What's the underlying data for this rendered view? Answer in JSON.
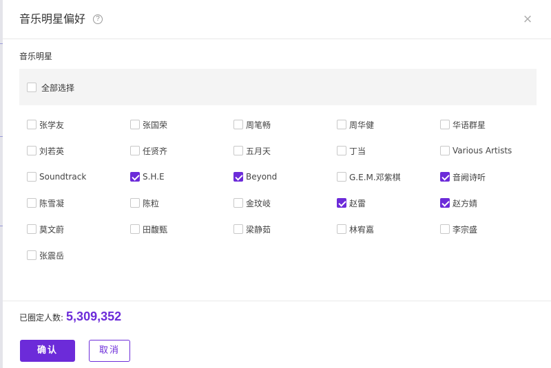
{
  "dialog": {
    "title": "音乐明星偏好",
    "help_icon": "help-circle-icon",
    "close_icon": "close-icon",
    "close_glyph": "×",
    "help_glyph": "?"
  },
  "section": {
    "label": "音乐明星",
    "select_all_label": "全部选择",
    "select_all_checked": false
  },
  "stars": [
    {
      "name": "张学友",
      "checked": false
    },
    {
      "name": "张国荣",
      "checked": false
    },
    {
      "name": "周笔畅",
      "checked": false
    },
    {
      "name": "周华健",
      "checked": false
    },
    {
      "name": "华语群星",
      "checked": false
    },
    {
      "name": "刘若英",
      "checked": false
    },
    {
      "name": "任贤齐",
      "checked": false
    },
    {
      "name": "五月天",
      "checked": false
    },
    {
      "name": "丁当",
      "checked": false
    },
    {
      "name": "Various Artists",
      "checked": false
    },
    {
      "name": "Soundtrack",
      "checked": false
    },
    {
      "name": "S.H.E",
      "checked": true
    },
    {
      "name": "Beyond",
      "checked": true
    },
    {
      "name": "G.E.M.邓紫棋",
      "checked": false
    },
    {
      "name": "音阙诗听",
      "checked": true
    },
    {
      "name": "陈雪凝",
      "checked": false
    },
    {
      "name": "陈粒",
      "checked": false
    },
    {
      "name": "金玟岐",
      "checked": false
    },
    {
      "name": "赵雷",
      "checked": true
    },
    {
      "name": "赵方婧",
      "checked": true
    },
    {
      "name": "莫文蔚",
      "checked": false
    },
    {
      "name": "田馥甄",
      "checked": false
    },
    {
      "name": "梁静茹",
      "checked": false
    },
    {
      "name": "林宥嘉",
      "checked": false
    },
    {
      "name": "李宗盛",
      "checked": false
    },
    {
      "name": "张震岳",
      "checked": false
    }
  ],
  "footer": {
    "count_label": "已圈定人数:",
    "count_value": "5,309,352",
    "confirm_label": "确认",
    "cancel_label": "取消"
  },
  "colors": {
    "accent": "#6c2bd9"
  }
}
